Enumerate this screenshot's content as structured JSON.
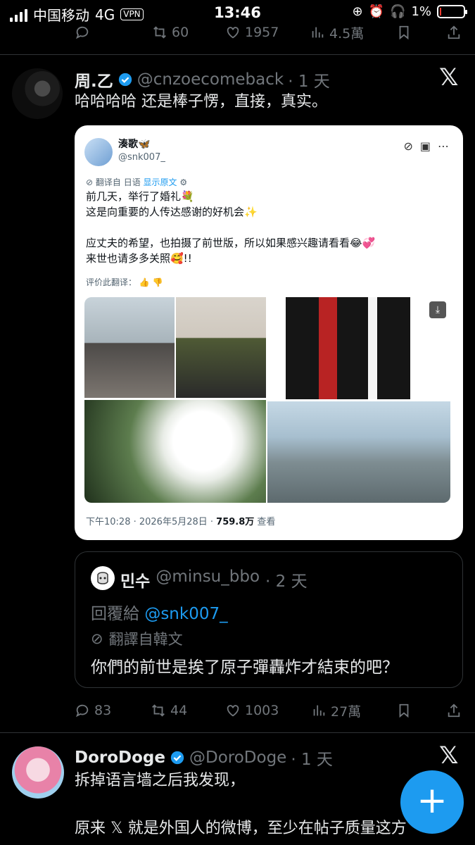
{
  "status_bar": {
    "carrier": "中国移动",
    "network": "4G",
    "vpn": "VPN",
    "time": "13:46",
    "battery": "1%"
  },
  "prev_actions": {
    "reposts": "60",
    "likes": "1957",
    "views": "4.5萬"
  },
  "tweet1": {
    "name": "周.乙",
    "handle": "@cnzoecomeback",
    "time": "· 1 天",
    "text": "哈哈哈哈  还是棒子愣，直接，真实。",
    "embed": {
      "name": "湊歌🦋",
      "handle": "@snk007_",
      "translated_from": "翻译自 日语",
      "show_original": "显示原文",
      "body": "前几天，举行了婚礼💐\n这是向重要的人传达感谢的好机会✨\n\n应丈夫的希望，也拍摄了前世版，所以如果感兴趣请看看😂💞\n来世也请多多关照🥰!!",
      "rate_label": "评价此翻译：",
      "timestamp": "下午10:28 · 2026年5月28日 · ",
      "views_count": "759.8万",
      "views_label": " 查看"
    },
    "quote": {
      "name": "민수",
      "handle": "@minsu_bbo",
      "time": "· 2 天",
      "reply_prefix": "回覆給 ",
      "reply_to": "@snk007_",
      "translated": "翻譯自韓文",
      "text": "你們的前世是挨了原子彈轟炸才結束的吧？"
    },
    "actions": {
      "replies": "83",
      "reposts": "44",
      "likes": "1003",
      "views": "27萬"
    }
  },
  "tweet2": {
    "name": "DoroDoge",
    "handle": "@DoroDoge",
    "time": "· 1 天",
    "line1": "拆掉语言墙之后我发现，",
    "line2": "原来 𝕏 就是外国人的微博，至少在帖子质量这方"
  },
  "icons": [
    "reply-icon",
    "repost-icon",
    "like-icon",
    "views-icon",
    "bookmark-icon",
    "share-icon",
    "verified-icon",
    "x-logo-icon",
    "compose-icon"
  ],
  "colors": {
    "accent": "#1d9bf0",
    "muted": "#71767b",
    "background": "#000000",
    "text": "#e7e9ea"
  }
}
